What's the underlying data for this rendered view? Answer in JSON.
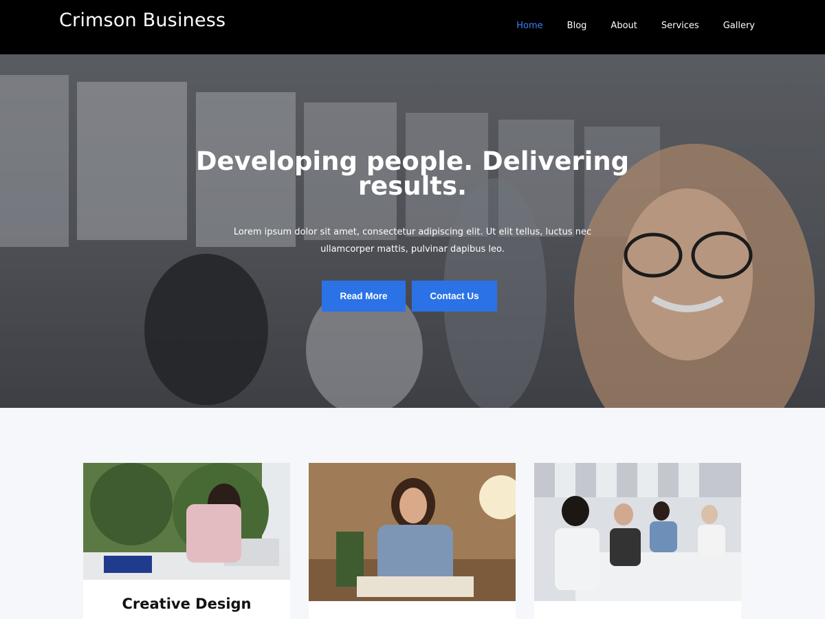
{
  "site": {
    "title": "Crimson Business"
  },
  "nav": {
    "items": [
      {
        "label": "Home",
        "active": true
      },
      {
        "label": "Blog",
        "active": false
      },
      {
        "label": "About",
        "active": false
      },
      {
        "label": "Services",
        "active": false
      },
      {
        "label": "Gallery",
        "active": false
      }
    ]
  },
  "hero": {
    "title": "Developing people. Delivering results.",
    "text": "Lorem ipsum dolor sit amet, consectetur adipiscing elit. Ut elit tellus, luctus nec ullamcorper mattis, pulvinar dapibus leo.",
    "buttons": {
      "read_more": "Read More",
      "contact": "Contact Us"
    }
  },
  "cards": [
    {
      "title": "Creative Design"
    },
    {
      "title": ""
    },
    {
      "title": ""
    }
  ],
  "colors": {
    "accent": "#2b72e6",
    "nav_active": "#3b82f6",
    "header_bg": "#000000",
    "section_bg": "#f5f7fb"
  }
}
